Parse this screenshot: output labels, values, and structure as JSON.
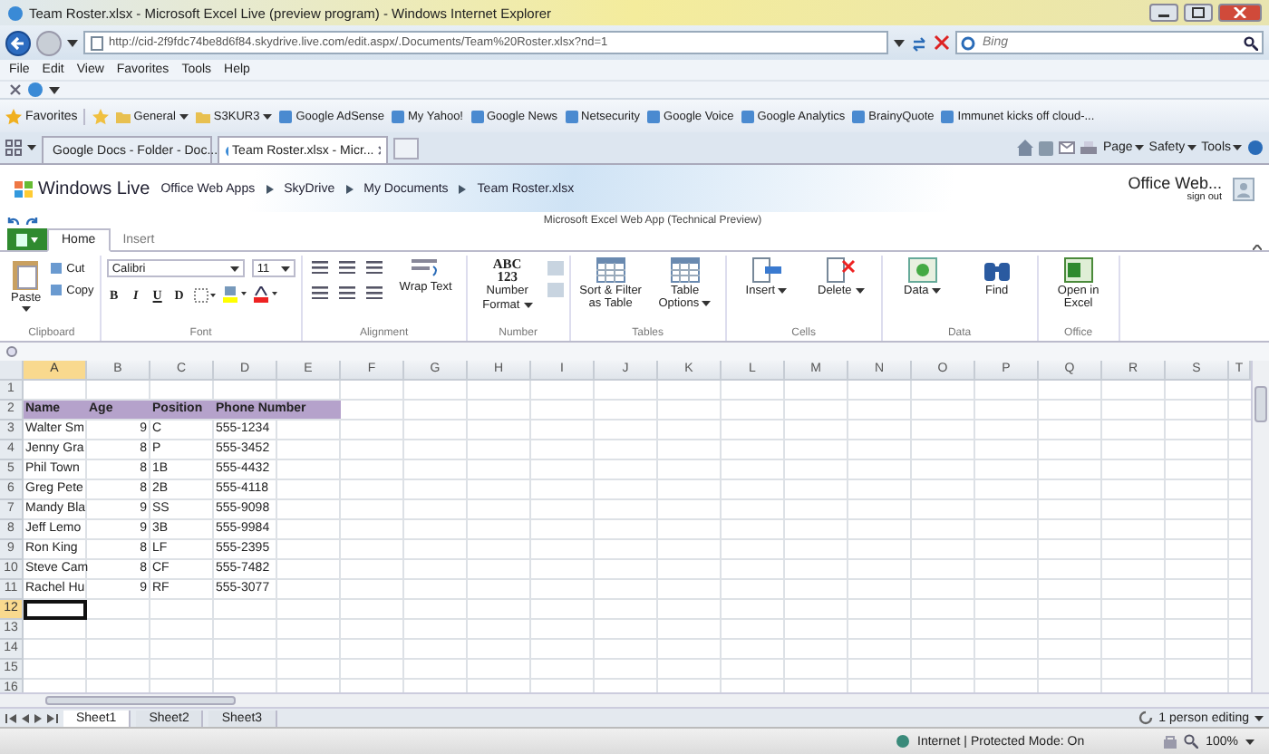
{
  "window": {
    "title": "Team Roster.xlsx - Microsoft Excel Live (preview program) - Windows Internet Explorer"
  },
  "address_bar": {
    "url": "http://cid-2f9fdc74be8d6f84.skydrive.live.com/edit.aspx/.Documents/Team%20Roster.xlsx?nd=1",
    "search_placeholder": "Bing"
  },
  "menu": [
    "File",
    "Edit",
    "View",
    "Favorites",
    "Tools",
    "Help"
  ],
  "favorites_bar": {
    "label": "Favorites",
    "items": [
      {
        "label": "General",
        "kind": "folder",
        "dropdown": true
      },
      {
        "label": "S3KUR3",
        "kind": "folder",
        "dropdown": true
      },
      {
        "label": "Google AdSense",
        "kind": "link",
        "dropdown": false
      },
      {
        "label": "My Yahoo!",
        "kind": "link",
        "dropdown": false
      },
      {
        "label": "Google News",
        "kind": "link",
        "dropdown": false
      },
      {
        "label": "Netsecurity",
        "kind": "link",
        "dropdown": false
      },
      {
        "label": "Google Voice",
        "kind": "link",
        "dropdown": false
      },
      {
        "label": "Google Analytics",
        "kind": "link",
        "dropdown": false
      },
      {
        "label": "BrainyQuote",
        "kind": "link",
        "dropdown": false
      },
      {
        "label": "Immunet kicks off cloud-...",
        "kind": "link",
        "dropdown": false
      }
    ]
  },
  "tabs": [
    {
      "label": "Google Docs - Folder - Doc...",
      "selected": false
    },
    {
      "label": "Team Roster.xlsx - Micr...",
      "selected": true
    }
  ],
  "command_bar": [
    "Page",
    "Safety",
    "Tools"
  ],
  "webapp": {
    "brand": "Windows Live",
    "breadcrumb": [
      "Office Web Apps",
      "SkyDrive",
      "My Documents",
      "Team Roster.xlsx"
    ],
    "account": "Office Web...",
    "sign_out": "sign out",
    "app_title": "Microsoft Excel Web App (Technical Preview)"
  },
  "ribbon_tabs": [
    {
      "label": "Home",
      "selected": true
    },
    {
      "label": "Insert",
      "selected": false
    }
  ],
  "ribbon_groups": [
    {
      "name": "Clipboard",
      "kind": "clipboard",
      "large": "Paste",
      "small": [
        "Cut",
        "Copy"
      ]
    },
    {
      "name": "Font",
      "kind": "font",
      "font": "Calibri",
      "size": "11",
      "styles": [
        "B",
        "I",
        "U",
        "D"
      ]
    },
    {
      "name": "Alignment",
      "kind": "alignment",
      "large": "Wrap Text"
    },
    {
      "name": "Number",
      "kind": "number",
      "large": "Number Format",
      "glyph": [
        "ABC",
        "123"
      ]
    },
    {
      "name": "Tables",
      "kind": "buttons",
      "buttons": [
        {
          "label": "Sort & Filter as Table",
          "dropdown": false
        },
        {
          "label": "Table Options",
          "dropdown": true
        }
      ]
    },
    {
      "name": "Cells",
      "kind": "buttons",
      "buttons": [
        {
          "label": "Insert",
          "dropdown": true
        },
        {
          "label": "Delete",
          "dropdown": true
        }
      ]
    },
    {
      "name": "Data",
      "kind": "buttons",
      "buttons": [
        {
          "label": "Data",
          "dropdown": true
        },
        {
          "label": "Find",
          "dropdown": false
        }
      ]
    },
    {
      "name": "Office",
      "kind": "buttons",
      "buttons": [
        {
          "label": "Open in Excel",
          "dropdown": false
        }
      ]
    }
  ],
  "sheet": {
    "columns": [
      {
        "letter": "A",
        "selected": true
      },
      {
        "letter": "B",
        "selected": false
      },
      {
        "letter": "C",
        "selected": false
      },
      {
        "letter": "D",
        "selected": false
      },
      {
        "letter": "E",
        "selected": false
      },
      {
        "letter": "F",
        "selected": false
      },
      {
        "letter": "G",
        "selected": false
      },
      {
        "letter": "H",
        "selected": false
      },
      {
        "letter": "I",
        "selected": false
      },
      {
        "letter": "J",
        "selected": false
      },
      {
        "letter": "K",
        "selected": false
      },
      {
        "letter": "L",
        "selected": false
      },
      {
        "letter": "M",
        "selected": false
      },
      {
        "letter": "N",
        "selected": false
      },
      {
        "letter": "O",
        "selected": false
      },
      {
        "letter": "P",
        "selected": false
      },
      {
        "letter": "Q",
        "selected": false
      },
      {
        "letter": "R",
        "selected": false
      },
      {
        "letter": "S",
        "selected": false
      },
      {
        "letter": "T",
        "selected": false
      }
    ],
    "rows": [
      {
        "number": "1",
        "header": false,
        "selected": false,
        "cells": []
      },
      {
        "number": "2",
        "header": true,
        "selected": false,
        "cells": [
          "Name",
          "Age",
          "Position",
          "Phone Number"
        ]
      },
      {
        "number": "3",
        "header": false,
        "selected": false,
        "cells": [
          "Walter Sm",
          "9",
          "C",
          "555-1234"
        ]
      },
      {
        "number": "4",
        "header": false,
        "selected": false,
        "cells": [
          "Jenny Gra",
          "8",
          "P",
          "555-3452"
        ]
      },
      {
        "number": "5",
        "header": false,
        "selected": false,
        "cells": [
          "Phil Town",
          "8",
          "1B",
          "555-4432"
        ]
      },
      {
        "number": "6",
        "header": false,
        "selected": false,
        "cells": [
          "Greg Pete",
          "8",
          "2B",
          "555-4118"
        ]
      },
      {
        "number": "7",
        "header": false,
        "selected": false,
        "cells": [
          "Mandy Bla",
          "9",
          "SS",
          "555-9098"
        ]
      },
      {
        "number": "8",
        "header": false,
        "selected": false,
        "cells": [
          "Jeff Lemo",
          "9",
          "3B",
          "555-9984"
        ]
      },
      {
        "number": "9",
        "header": false,
        "selected": false,
        "cells": [
          "Ron King",
          "8",
          "LF",
          "555-2395"
        ]
      },
      {
        "number": "10",
        "header": false,
        "selected": false,
        "cells": [
          "Steve Cam",
          "8",
          "CF",
          "555-7482"
        ]
      },
      {
        "number": "11",
        "header": false,
        "selected": false,
        "cells": [
          "Rachel Hu",
          "9",
          "RF",
          "555-3077"
        ]
      },
      {
        "number": "12",
        "header": false,
        "selected": true,
        "cells": []
      },
      {
        "number": "13",
        "header": false,
        "selected": false,
        "cells": []
      },
      {
        "number": "14",
        "header": false,
        "selected": false,
        "cells": []
      },
      {
        "number": "15",
        "header": false,
        "selected": false,
        "cells": []
      },
      {
        "number": "16",
        "header": false,
        "selected": false,
        "cells": []
      }
    ]
  },
  "sheet_tabs": [
    {
      "label": "Sheet1",
      "selected": true
    },
    {
      "label": "Sheet2",
      "selected": false
    },
    {
      "label": "Sheet3",
      "selected": false
    }
  ],
  "editing": "1 person editing",
  "status_bar": {
    "zone": "Internet | Protected Mode: On",
    "zoom": "100%"
  }
}
